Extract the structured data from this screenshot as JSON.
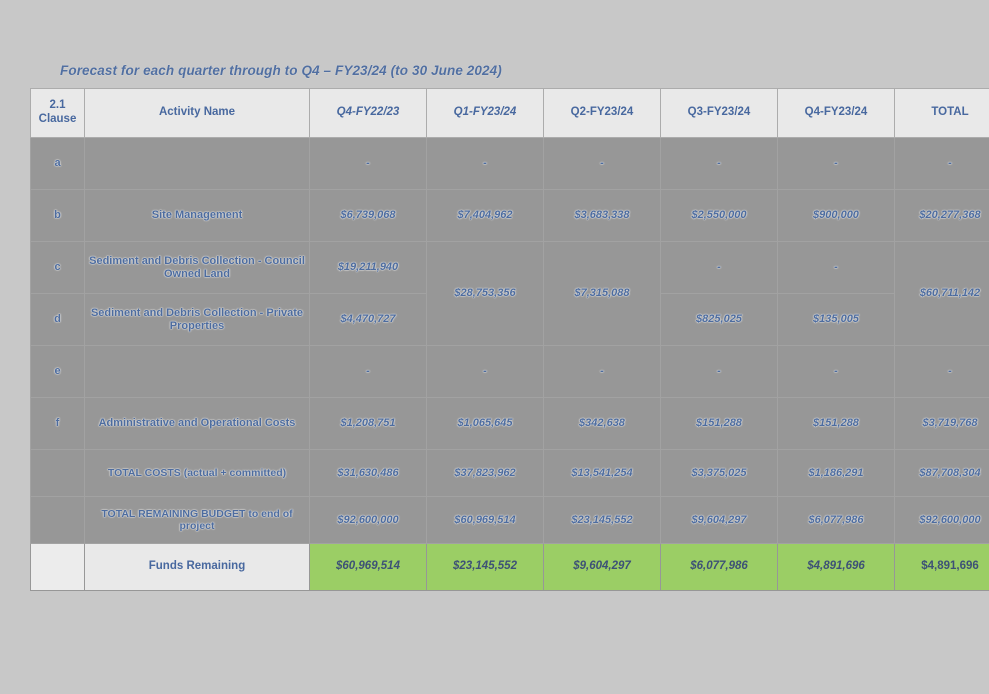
{
  "document": {
    "title": "Forecast for each quarter through to Q4 – FY23/24 (to 30 June 2024)",
    "accent_color": "#2c5496",
    "highlight_color": "#92d050",
    "background_color": "#c9c9c9"
  },
  "table": {
    "headers": [
      "2.1\nClause",
      "Activity Name",
      "Q4-FY22/23",
      "Q1-FY23/24",
      "Q2-FY23/24",
      "Q3-FY23/24",
      "Q4-FY23/24",
      "TOTAL"
    ],
    "header_clause_line1": "2.1",
    "header_clause_line2": "Clause",
    "rows": [
      {
        "clause": "a",
        "activity": "",
        "q4_fy2223": "-",
        "q1_fy2324": "-",
        "q2_fy2324": "-",
        "q3_fy2324": "-",
        "q4_fy2324": "-",
        "total": "-"
      },
      {
        "clause": "b",
        "activity": "Site Management",
        "q4_fy2223": "$6,739,068",
        "q1_fy2324": "$7,404,962",
        "q2_fy2324": "$3,683,338",
        "q3_fy2324": "$2,550,000",
        "q4_fy2324": "$900,000",
        "total": "$20,277,368"
      },
      {
        "clause": "c",
        "activity": "Sediment and Debris Collection - Council Owned Land",
        "q4_fy2223": "$19,211,940",
        "q1_fy2324": "$28,753,356",
        "q2_fy2324": "$7,315,088",
        "q3_fy2324": "-",
        "q4_fy2324": "-",
        "total": "$60,711,142"
      },
      {
        "clause": "d",
        "activity": "Sediment and Debris Collection - Private Properties",
        "q4_fy2223": "$4,470,727",
        "q1_fy2324": "",
        "q2_fy2324": "",
        "q3_fy2324": "$825,025",
        "q4_fy2324": "$135,005",
        "total": ""
      },
      {
        "clause": "e",
        "activity": "",
        "q4_fy2223": "-",
        "q1_fy2324": "-",
        "q2_fy2324": "-",
        "q3_fy2324": "-",
        "q4_fy2324": "-",
        "total": "-"
      },
      {
        "clause": "f",
        "activity": "Administrative and Operational Costs",
        "q4_fy2223": "$1,208,751",
        "q1_fy2324": "$1,065,645",
        "q2_fy2324": "$342,638",
        "q3_fy2324": "$151,288",
        "q4_fy2324": "$151,288",
        "total": "$3,719,768"
      }
    ],
    "total_costs_row": {
      "clause": "",
      "activity": "TOTAL COSTS (actual + committed)",
      "q4_fy2223": "$31,630,486",
      "q1_fy2324": "$37,823,962",
      "q2_fy2324": "$13,541,254",
      "q3_fy2324": "$3,375,025",
      "q4_fy2324": "$1,186,291",
      "total": "$87,708,304"
    },
    "remaining_budget_row": {
      "clause": "",
      "activity": "TOTAL REMAINING BUDGET to end of project",
      "q4_fy2223": "$92,600,000",
      "q1_fy2324": "$60,969,514",
      "q2_fy2324": "$23,145,552",
      "q3_fy2324": "$9,604,297",
      "q4_fy2324": "$6,077,986",
      "total": "$92,600,000"
    },
    "funds_remaining_row": {
      "clause": "",
      "activity": "Funds Remaining",
      "q4_fy2223": "$60,969,514",
      "q1_fy2324": "$23,145,552",
      "q2_fy2324": "$9,604,297",
      "q3_fy2324": "$6,077,986",
      "q4_fy2324": "$4,891,696",
      "total": "$4,891,696"
    }
  }
}
